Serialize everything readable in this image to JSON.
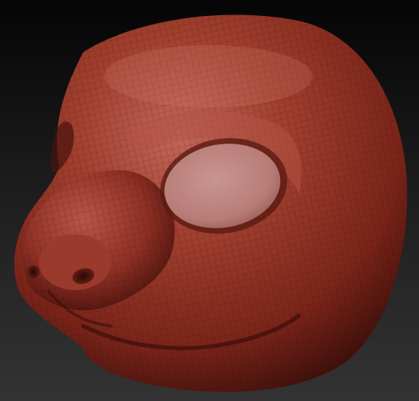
{
  "viewport": {
    "background_top": "#050505",
    "background_mid": "#1c1c1c",
    "background_bottom": "#333333"
  },
  "model": {
    "subject": "sculpted-animal-head-mask",
    "material_color": "#8e2f24",
    "highlight_color": "#c2665a",
    "shadow_color": "#3a0e0a",
    "eye_socket_color": "#b87c77",
    "wireframe_visible": true
  }
}
